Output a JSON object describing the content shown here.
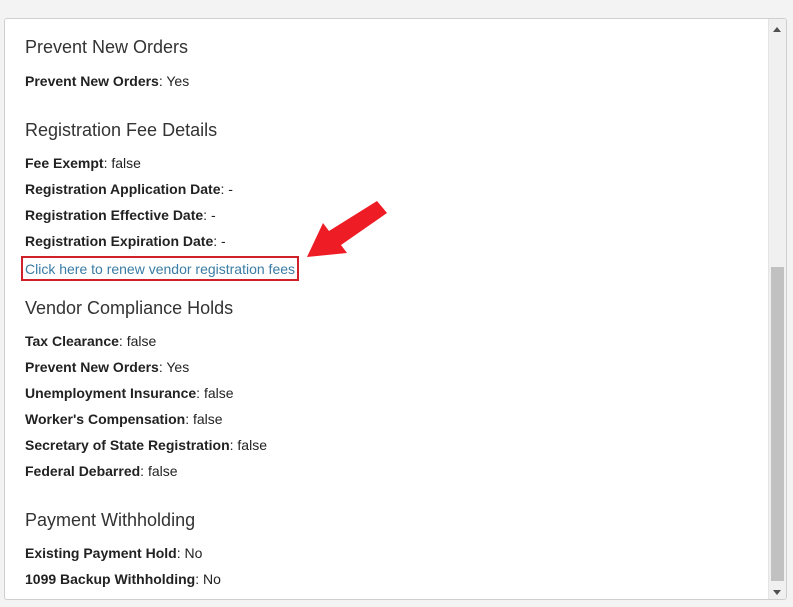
{
  "sections": {
    "prevent": {
      "title": "Prevent New Orders",
      "rows": [
        {
          "label": "Prevent New Orders",
          "value": "Yes"
        }
      ]
    },
    "registration": {
      "title": "Registration Fee Details",
      "rows": [
        {
          "label": "Fee Exempt",
          "value": "false"
        },
        {
          "label": "Registration Application Date",
          "value": "-"
        },
        {
          "label": "Registration Effective Date",
          "value": "-"
        },
        {
          "label": "Registration Expiration Date",
          "value": "-"
        }
      ],
      "renew_link": "Click here to renew vendor registration fees"
    },
    "compliance": {
      "title": "Vendor Compliance Holds",
      "rows": [
        {
          "label": "Tax Clearance",
          "value": "false"
        },
        {
          "label": "Prevent New Orders",
          "value": "Yes"
        },
        {
          "label": "Unemployment Insurance",
          "value": "false"
        },
        {
          "label": "Worker's Compensation",
          "value": "false"
        },
        {
          "label": "Secretary of State Registration",
          "value": "false"
        },
        {
          "label": "Federal Debarred",
          "value": "false"
        }
      ]
    },
    "withholding": {
      "title": "Payment Withholding",
      "rows": [
        {
          "label": "Existing Payment Hold",
          "value": "No"
        },
        {
          "label": "1099 Backup Withholding",
          "value": "No"
        }
      ]
    }
  },
  "icons": {
    "annotation_arrow": "red-arrow-icon",
    "scroll_up": "scroll-up-arrow-icon",
    "scroll_down": "scroll-down-arrow-icon"
  },
  "colors": {
    "link": "#3a7ca5",
    "highlight_box": "#d0202a",
    "arrow": "#ee1c25"
  }
}
